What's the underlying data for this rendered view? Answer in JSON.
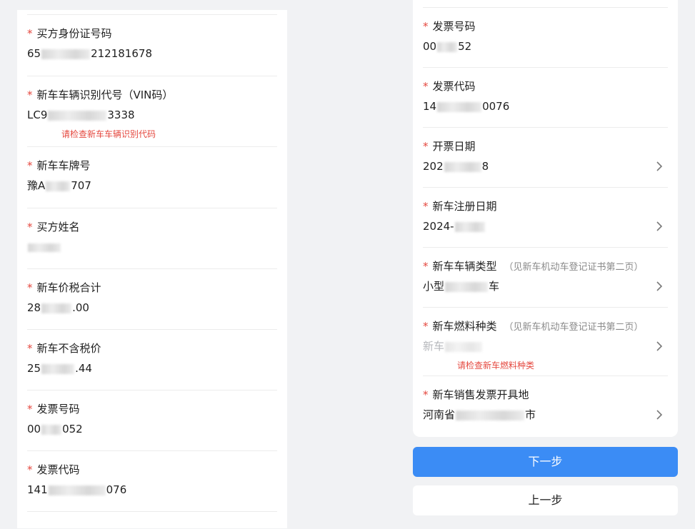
{
  "left_form": {
    "fields": [
      {
        "label": "买方身份证号码",
        "value_start": "65",
        "value_end": "212181678"
      },
      {
        "label": "新车车辆识别代号（VIN码）",
        "value_start": "LC9",
        "value_end": "3338",
        "error": "请检查新车车辆识别代码"
      },
      {
        "label": "新车车牌号",
        "value_start": "豫A",
        "value_end": "707"
      },
      {
        "label": "买方姓名",
        "value_start": "",
        "value_end": ""
      },
      {
        "label": "新车价税合计",
        "value_start": "28",
        "value_end": ".00"
      },
      {
        "label": "新车不含税价",
        "value_start": "25",
        "value_end": ".44"
      },
      {
        "label": "发票号码",
        "value_start": "00",
        "value_end": "052"
      },
      {
        "label": "发票代码",
        "value_start": "141",
        "value_end": "076"
      }
    ]
  },
  "right_form": {
    "fields": [
      {
        "label": "发票号码",
        "value_start": "00",
        "value_end": "52"
      },
      {
        "label": "发票代码",
        "value_start": "14",
        "value_end": "0076"
      },
      {
        "label": "开票日期",
        "value_start": "202",
        "value_end": "8"
      },
      {
        "label": "新车注册日期",
        "value_start": "2024-",
        "value_end": ""
      },
      {
        "label": "新车车辆类型",
        "note": "（见新车机动车登记证书第二页）",
        "value_start": "小型",
        "value_end": "车"
      },
      {
        "label": "新车燃料种类",
        "note": "（见新车机动车登记证书第二页）",
        "value_start": "新车",
        "value_end": "",
        "placeholder": true,
        "error": "请检查新车燃料种类"
      },
      {
        "label": "新车销售发票开具地",
        "value_start": "河南省",
        "value_end": "市"
      }
    ]
  },
  "required_mark": "*",
  "buttons": {
    "next_label": "下一步",
    "prev_label": "上一步"
  },
  "colors": {
    "primary": "#3b8cf5",
    "required": "#e5483f",
    "error": "#e5483f",
    "background": "#f1f2f4"
  },
  "icons": {
    "chevron": "chevron-right-icon"
  }
}
